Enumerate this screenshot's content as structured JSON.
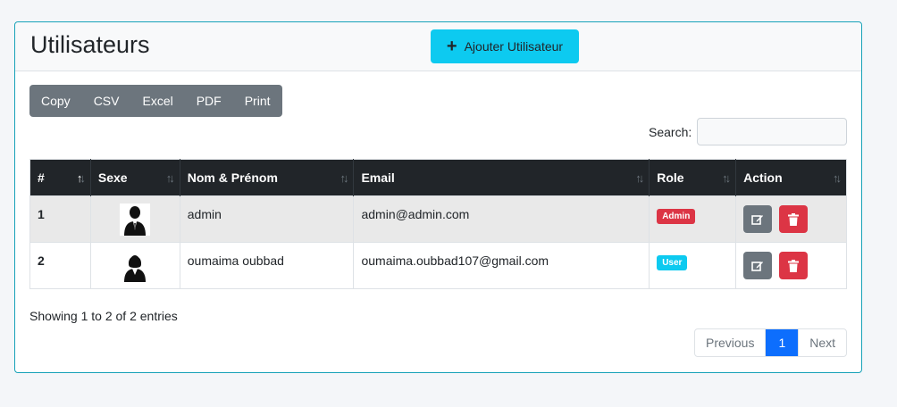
{
  "header": {
    "title": "Utilisateurs",
    "add_button": "Ajouter Utilisateur"
  },
  "toolbar": {
    "buttons": [
      "Copy",
      "CSV",
      "Excel",
      "PDF",
      "Print"
    ]
  },
  "search": {
    "label": "Search:",
    "value": ""
  },
  "table": {
    "columns": [
      "#",
      "Sexe",
      "Nom & Prénom",
      "Email",
      "Role",
      "Action"
    ],
    "rows": [
      {
        "num": "1",
        "gender": "male",
        "name": "admin",
        "email": "admin@admin.com",
        "role": "Admin"
      },
      {
        "num": "2",
        "gender": "female",
        "name": "oumaima oubbad",
        "email": "oumaima.oubbad107@gmail.com",
        "role": "User"
      }
    ]
  },
  "footer": {
    "info": "Showing 1 to 2 of 2 entries"
  },
  "pagination": {
    "prev": "Previous",
    "current": "1",
    "next": "Next"
  },
  "colors": {
    "accent": "#0dcaf0",
    "danger": "#dc3545",
    "secondary": "#6c757d",
    "primary": "#0d6efd"
  }
}
